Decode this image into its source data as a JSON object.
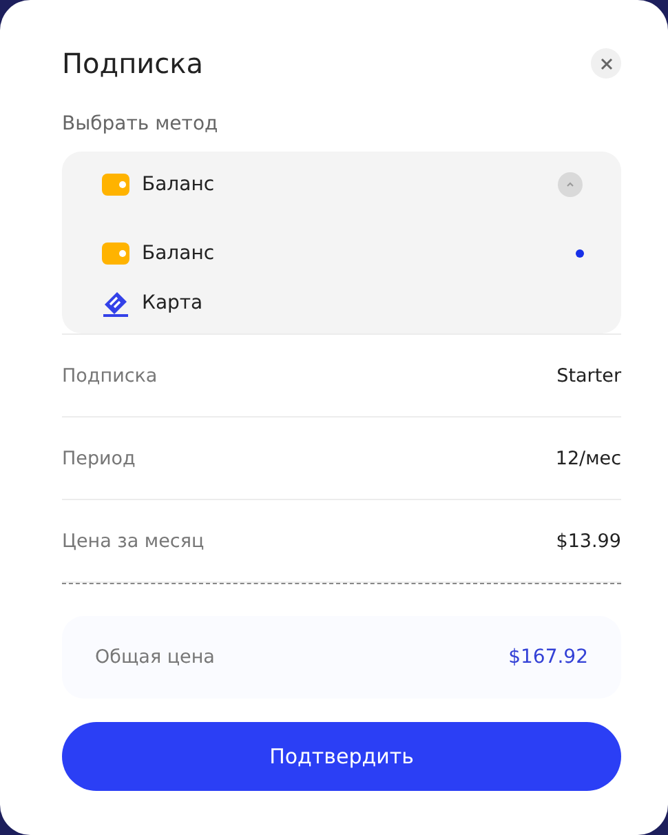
{
  "dialog": {
    "title": "Подписка"
  },
  "method": {
    "label": "Выбрать метод",
    "current": {
      "label": "Баланс",
      "kind": "wallet"
    },
    "expanded": true,
    "options": [
      {
        "label": "Баланс",
        "kind": "wallet",
        "selected": true
      },
      {
        "label": "Карта",
        "kind": "card",
        "selected": false
      }
    ]
  },
  "details": [
    {
      "label": "Подписка",
      "value": "Starter"
    },
    {
      "label": "Период",
      "value": "12/мес"
    },
    {
      "label": "Цена за месяц",
      "value": "$13.99"
    }
  ],
  "total": {
    "label": "Общая цена",
    "value": "$167.92"
  },
  "confirm_button": "Подтвердить"
}
